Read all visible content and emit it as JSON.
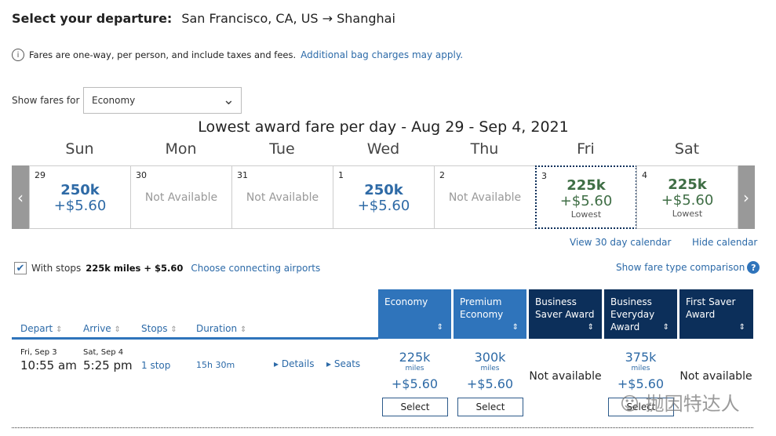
{
  "header": {
    "label": "Select your departure:",
    "route": "San Francisco, CA, US → Shanghai"
  },
  "info": {
    "icon": "info-icon",
    "text": "Fares are one-way, per person, and include taxes and fees.",
    "link": "Additional bag charges may apply."
  },
  "fare_filter": {
    "label": "Show fares for",
    "value": "Economy"
  },
  "calendar": {
    "title": "Lowest award fare per day - Aug 29 - Sep 4, 2021",
    "days": [
      {
        "name": "Sun",
        "date": "29",
        "miles": "250k",
        "tax": "+$5.60"
      },
      {
        "name": "Mon",
        "date": "30",
        "status": "Not Available"
      },
      {
        "name": "Tue",
        "date": "31",
        "status": "Not Available"
      },
      {
        "name": "Wed",
        "date": "1",
        "miles": "250k",
        "tax": "+$5.60"
      },
      {
        "name": "Thu",
        "date": "2",
        "status": "Not Available"
      },
      {
        "name": "Fri",
        "date": "3",
        "miles": "225k",
        "tax": "+$5.60",
        "badge": "Lowest",
        "selected": true
      },
      {
        "name": "Sat",
        "date": "4",
        "miles": "225k",
        "tax": "+$5.60",
        "badge": "Lowest"
      }
    ],
    "view30": "View 30 day calendar",
    "hide": "Hide calendar"
  },
  "stops": {
    "checked": true,
    "label": "With stops",
    "price": "225k miles + $5.60",
    "link": "Choose connecting airports"
  },
  "compare_link": "Show fare type comparison",
  "columns": [
    "Depart",
    "Arrive",
    "Stops",
    "Duration"
  ],
  "fare_columns": [
    "Economy",
    "Premium Economy",
    "Business Saver Award",
    "Business Everyday Award",
    "First Saver Award"
  ],
  "colors": {
    "light_header": "#2f74bb",
    "dark_header": "#0c2f5a",
    "link": "#2c6aa8",
    "lowest": "#3f6e45"
  },
  "flight": {
    "depart_date": "Fri, Sep 3",
    "depart_time": "10:55 am",
    "arrive_date": "Sat, Sep 4",
    "arrive_time": "5:25 pm",
    "stops": "1 stop",
    "duration": "15h 30m",
    "details": "Details",
    "seats": "Seats",
    "fares": [
      {
        "miles": "225k",
        "unit": "miles",
        "tax": "+$5.60",
        "button": "Select"
      },
      {
        "miles": "300k",
        "unit": "miles",
        "tax": "+$5.60",
        "button": "Select"
      },
      {
        "status": "Not available"
      },
      {
        "miles": "375k",
        "unit": "miles",
        "tax": "+$5.60",
        "button": "Select"
      },
      {
        "status": "Not available"
      }
    ]
  },
  "watermark": "抛因特达人"
}
